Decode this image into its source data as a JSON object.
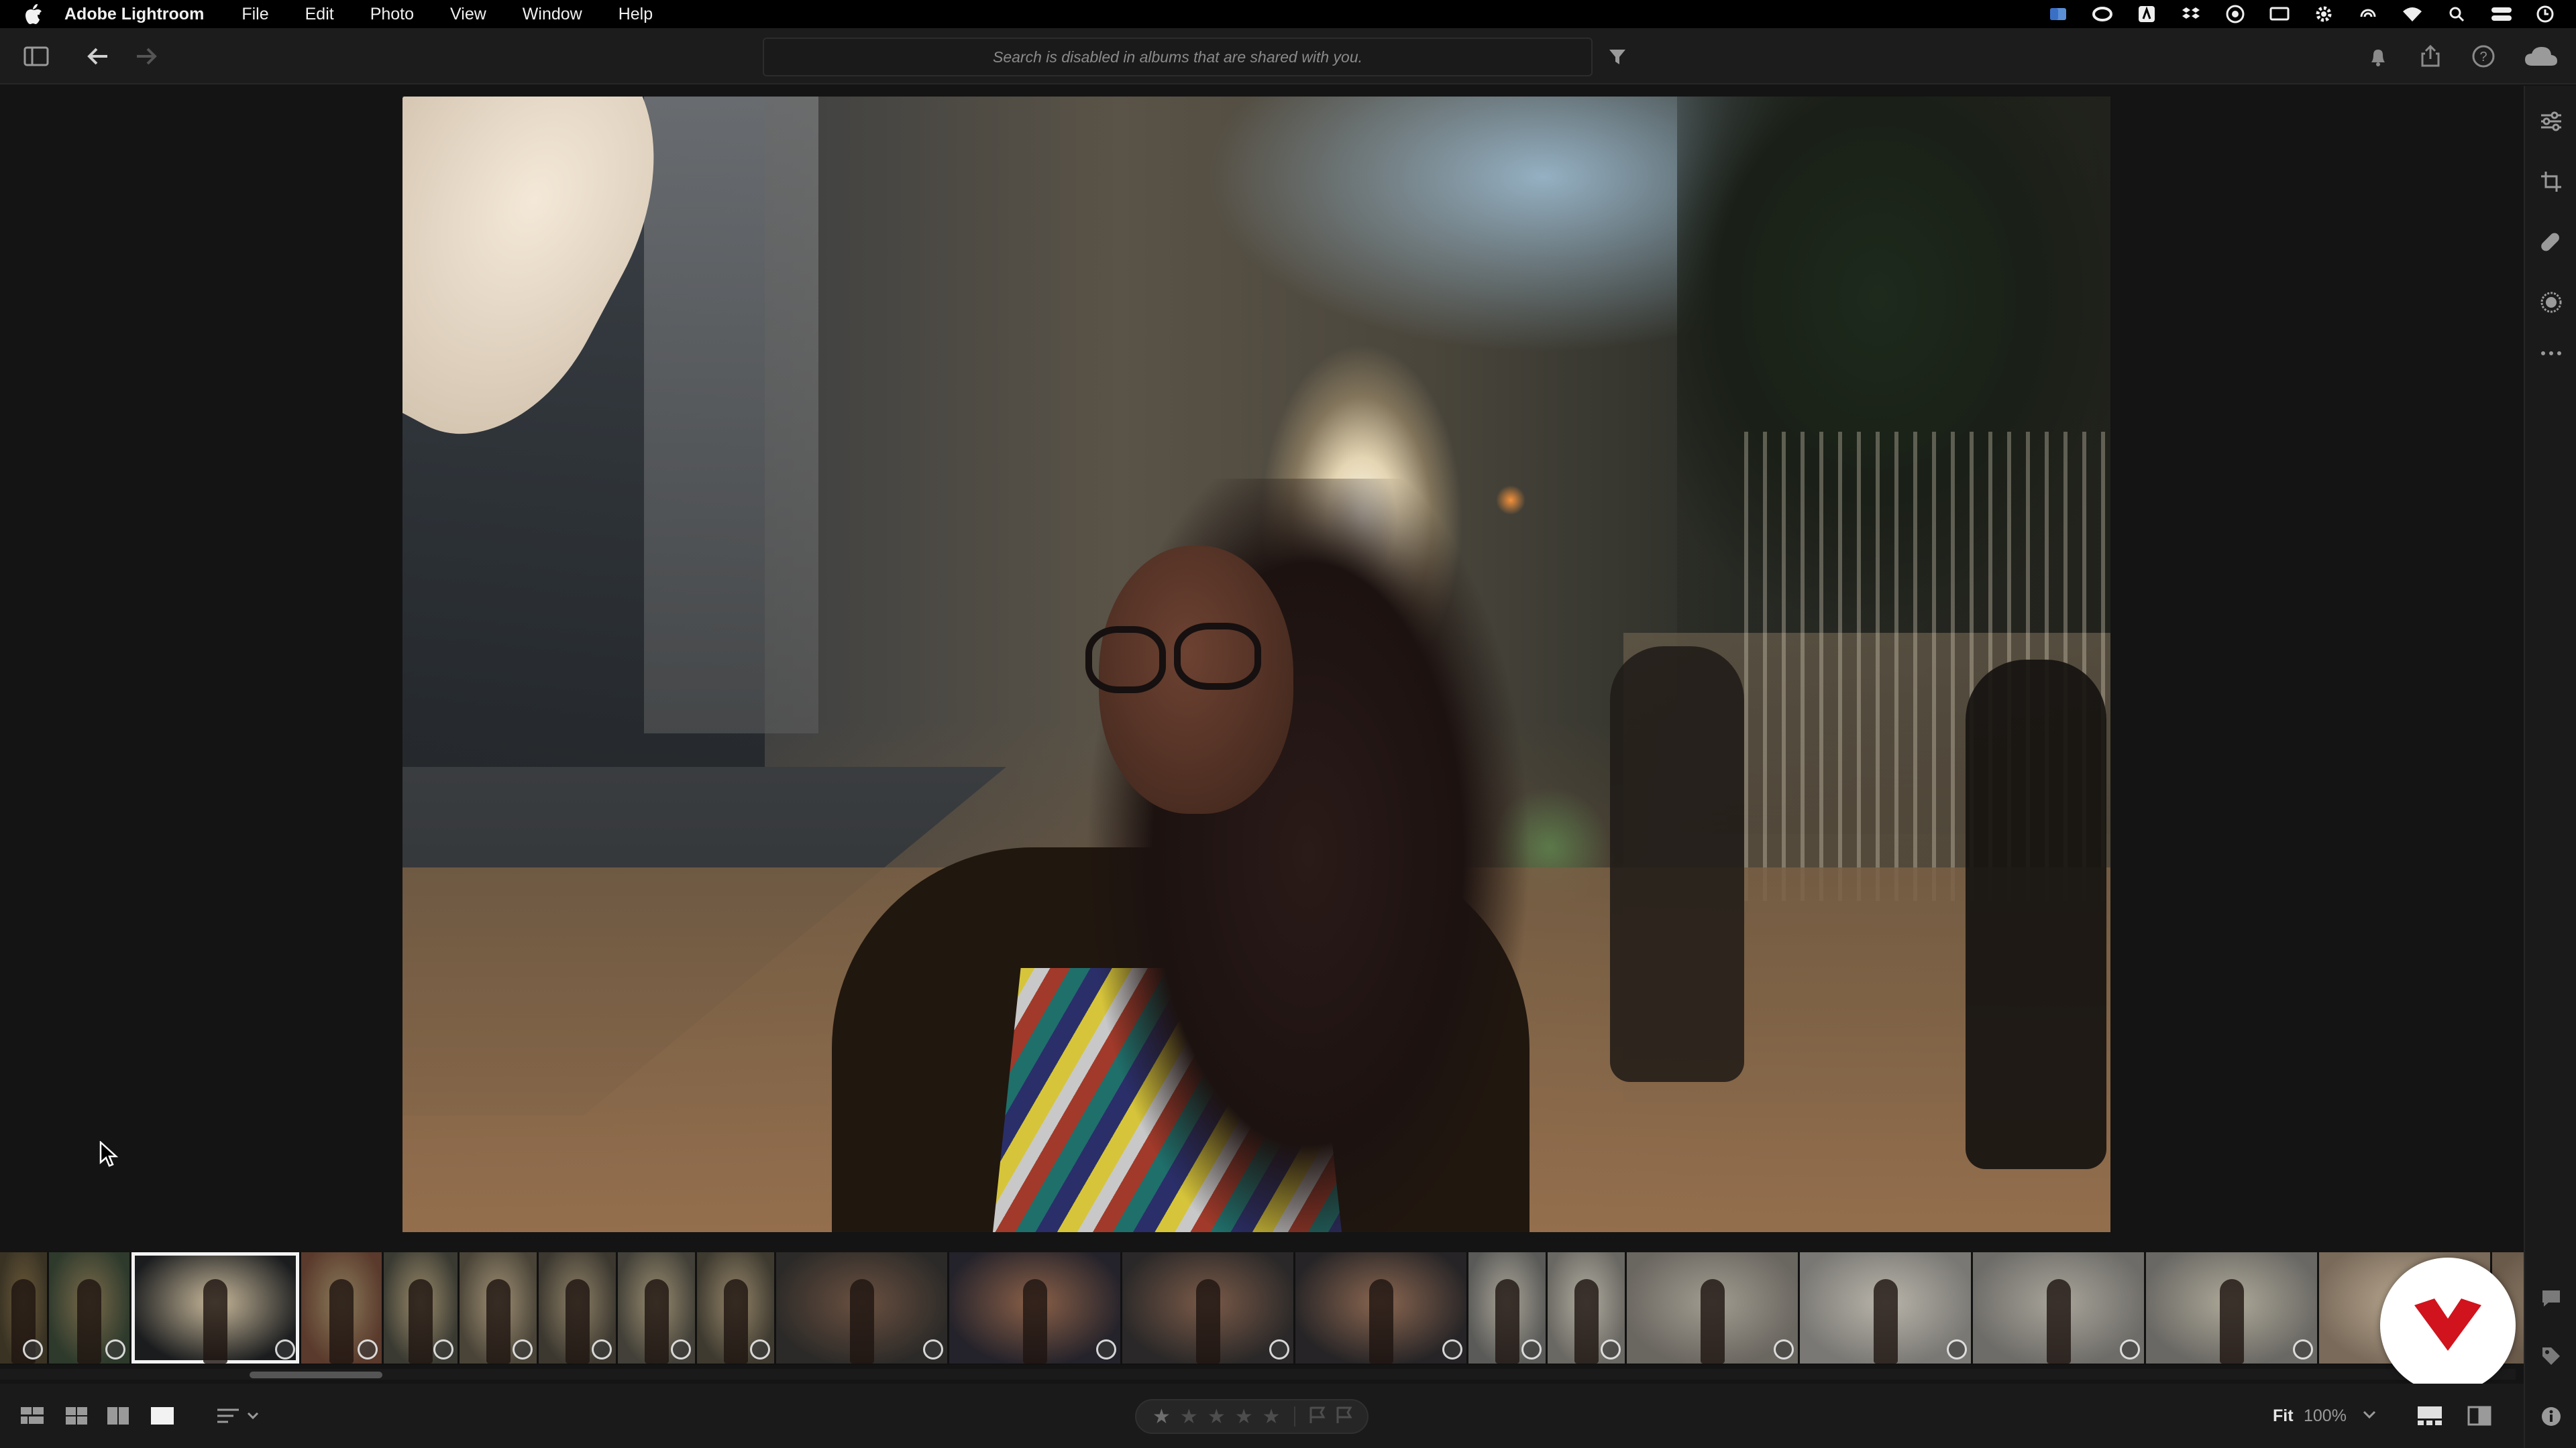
{
  "menubar": {
    "app_name": "Adobe Lightroom",
    "items": [
      "File",
      "Edit",
      "Photo",
      "View",
      "Window",
      "Help"
    ],
    "status_icons": [
      "finder-icon",
      "creative-cloud-icon",
      "adobe-icon",
      "dropbox-icon",
      "sync-icon",
      "screen-icon",
      "gear-icon",
      "airdrop-icon",
      "wifi-icon",
      "search-icon",
      "control-center-icon",
      "clock-icon"
    ]
  },
  "toolbar": {
    "search_placeholder": "Search is disabled in albums that are shared with you.",
    "icons": [
      "sidebar-toggle-icon",
      "back-arrow-icon",
      "forward-arrow-icon",
      "filter-icon",
      "bell-icon",
      "share-icon",
      "help-icon",
      "cloud-icon"
    ]
  },
  "filmstrip": {
    "selected_index": 2,
    "thumb_count": 23
  },
  "bottombar": {
    "fit_label": "Fit",
    "zoom_label": "100%",
    "view_icons": [
      "square-grid-icon",
      "grid-icon",
      "detail-grid-icon",
      "single-view-icon",
      "sort-icon"
    ],
    "rating": {
      "stars": 5,
      "value": 0
    }
  },
  "rightstrip": {
    "icons": [
      "edit-sliders-icon",
      "crop-icon",
      "healing-icon",
      "masking-icon",
      "more-icon",
      "comments-icon",
      "tag-icon",
      "info-icon"
    ]
  },
  "colors": {
    "background": "#141414",
    "panel": "#1c1c1c",
    "logo_red": "#d1131d"
  }
}
